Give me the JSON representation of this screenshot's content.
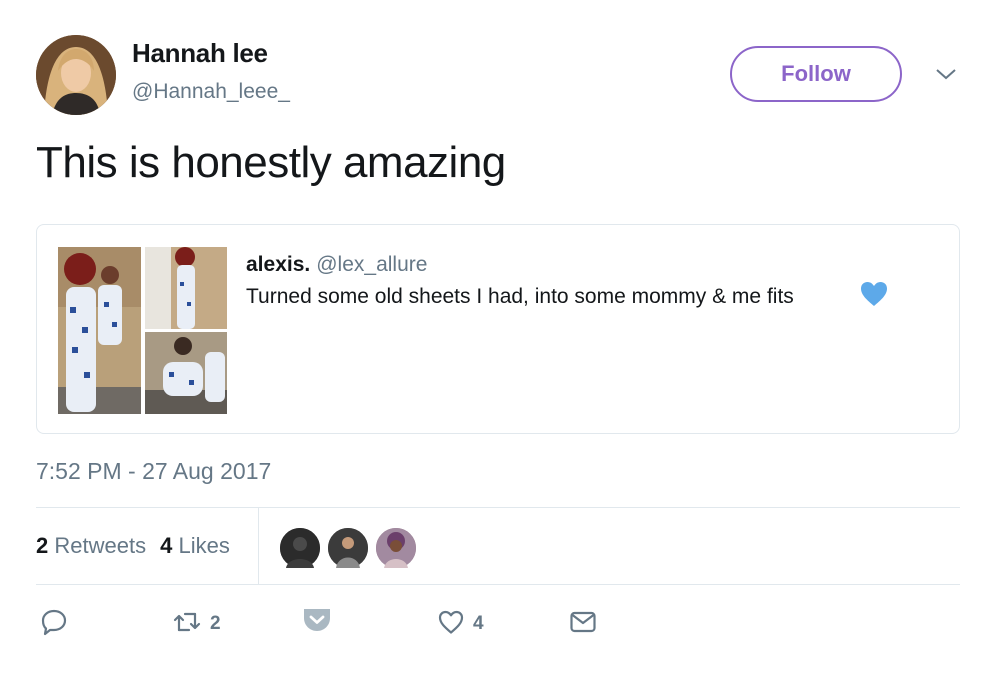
{
  "author": {
    "name": "Hannah lee",
    "handle": "@Hannah_leee_"
  },
  "follow_button": {
    "label": "Follow"
  },
  "tweet": {
    "text": "This is honestly amazing",
    "timestamp": "7:52 PM - 27 Aug 2017"
  },
  "quoted_tweet": {
    "name": "alexis.",
    "handle": "@lex_allure",
    "text": "Turned some old sheets I had, into some mommy & me fits",
    "emoji": "blue-heart-icon"
  },
  "stats": {
    "retweets_count": "2",
    "retweets_label": "Retweets",
    "likes_count": "4",
    "likes_label": "Likes"
  },
  "actions": {
    "retweet_count": "2",
    "like_count": "4"
  },
  "colors": {
    "accent": "#8c65c9",
    "muted": "#657786",
    "border": "#e1e8ed",
    "heart": "#5da9e9"
  }
}
